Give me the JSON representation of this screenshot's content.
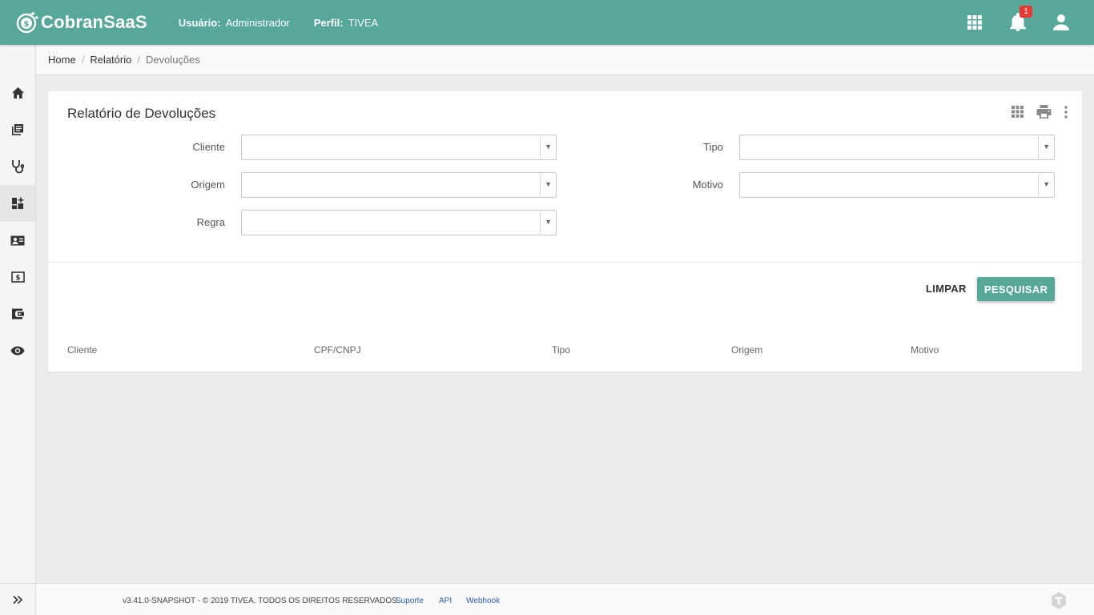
{
  "app": {
    "name": "CobranSaaS"
  },
  "header": {
    "user_label": "Usuário:",
    "user_value": "Administrador",
    "profile_label": "Perfil:",
    "profile_value": "TIVEA",
    "notification_count": "1",
    "icons": [
      "apps-icon",
      "bell-icon",
      "account-icon"
    ]
  },
  "breadcrumb": {
    "home": "Home",
    "relatorio": "Relatório",
    "current": "Devoluções",
    "separator": "/"
  },
  "sidebar": {
    "items": [
      "home-icon",
      "library-books-icon",
      "stethoscope-icon",
      "dashboard-plus-icon",
      "contact-card-icon",
      "money-icon",
      "wallet-icon",
      "eye-icon"
    ],
    "active_index": 3,
    "expand_icon": "chevron-double-right-icon"
  },
  "report": {
    "title": "Relatório de Devoluções",
    "tools": [
      "grid-icon",
      "print-icon",
      "more-vertical-icon"
    ],
    "filters": {
      "cliente": {
        "label": "Cliente",
        "value": ""
      },
      "tipo": {
        "label": "Tipo",
        "value": ""
      },
      "origem": {
        "label": "Origem",
        "value": ""
      },
      "motivo": {
        "label": "Motivo",
        "value": ""
      },
      "regra": {
        "label": "Regra",
        "value": ""
      }
    },
    "buttons": {
      "clear": "LIMPAR",
      "search": "PESQUISAR"
    },
    "columns": [
      "Cliente",
      "CPF/CNPJ",
      "Tipo",
      "Origem",
      "Motivo"
    ]
  },
  "footer": {
    "copyright": "v3.41.0-SNAPSHOT - © 2019 TIVEA. TODOS OS DIREITOS RESERVADOS.",
    "links": [
      "Suporte",
      "API",
      "Webhook"
    ]
  },
  "colors": {
    "primary": "#57a899",
    "badge": "#e53935",
    "link": "#2a5db0"
  }
}
